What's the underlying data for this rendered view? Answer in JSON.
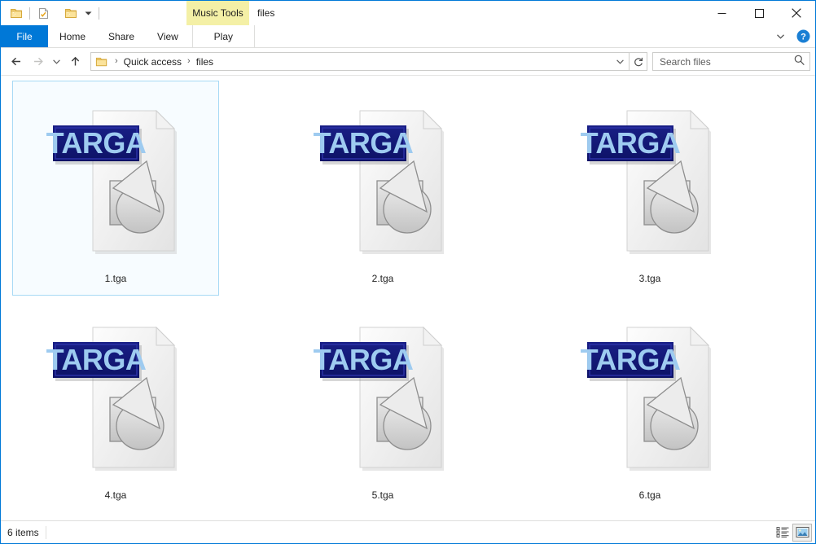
{
  "window": {
    "title": "files",
    "contextual_tab_header": "Music Tools",
    "accent_color": "#0078d7",
    "controls": [
      {
        "name": "minimize",
        "glyph": "minimize-icon"
      },
      {
        "name": "maximize",
        "glyph": "maximize-icon"
      },
      {
        "name": "close",
        "glyph": "close-icon"
      }
    ]
  },
  "quick_access_toolbar": {
    "items": [
      {
        "name": "pin-to-quick-access",
        "icon": "folder-icon"
      },
      {
        "name": "properties",
        "icon": "properties-document-icon"
      },
      {
        "name": "new-folder",
        "icon": "new-folder-icon"
      },
      {
        "name": "customize-quick-access-toolbar",
        "icon": "chevron-down-icon"
      }
    ]
  },
  "ribbon": {
    "tabs": [
      {
        "label": "File",
        "selected": true
      },
      {
        "label": "Home",
        "selected": false
      },
      {
        "label": "Share",
        "selected": false
      },
      {
        "label": "View",
        "selected": false
      },
      {
        "label": "Play",
        "selected": false,
        "contextual": true
      }
    ],
    "expand_icon": "chevron-down-icon",
    "help_icon": "help-icon",
    "contextual_color": "#f4f0a6"
  },
  "address_bar": {
    "back_icon": "back-arrow-icon",
    "forward_icon": "forward-arrow-icon",
    "recent_icon": "chevron-down-icon",
    "up_icon": "up-arrow-icon",
    "folder_icon": "folder-icon",
    "breadcrumbs": [
      {
        "label": "Quick access"
      },
      {
        "label": "files"
      }
    ],
    "separator": "›",
    "dropdown_icon": "chevron-down-icon",
    "refresh_icon": "refresh-icon"
  },
  "search": {
    "placeholder": "Search files",
    "value": "",
    "icon": "search-icon"
  },
  "file_list": {
    "view_mode": "large-icons",
    "columns": 3,
    "items": [
      {
        "name": "1.tga",
        "type": "targa-image",
        "selected": true
      },
      {
        "name": "2.tga",
        "type": "targa-image",
        "selected": false
      },
      {
        "name": "3.tga",
        "type": "targa-image",
        "selected": false
      },
      {
        "name": "4.tga",
        "type": "targa-image",
        "selected": false
      },
      {
        "name": "5.tga",
        "type": "targa-image",
        "selected": false
      },
      {
        "name": "6.tga",
        "type": "targa-image",
        "selected": false
      }
    ],
    "icon_banner_text": "TARGA",
    "icon_banner_color": "#151a78",
    "icon_banner_text_color": "#9ecbf0",
    "selection_border_color": "#a7d9f5",
    "selection_fill_color": "#f7fcff"
  },
  "status_bar": {
    "item_count_text": "6 items",
    "views": [
      {
        "name": "details-view",
        "icon": "details-view-icon",
        "active": false
      },
      {
        "name": "large-icons-view",
        "icon": "large-icons-view-icon",
        "active": true
      }
    ]
  }
}
